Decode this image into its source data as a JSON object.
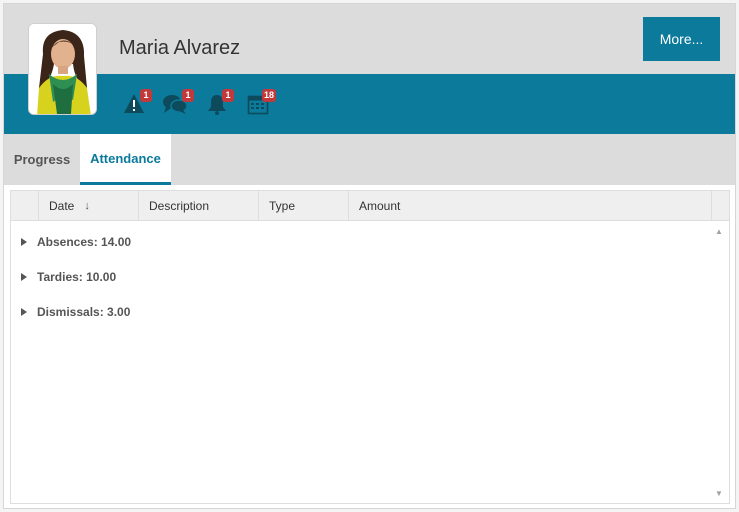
{
  "student": {
    "name": "Maria Alvarez"
  },
  "header": {
    "more_label": "More..."
  },
  "alerts": [
    {
      "icon": "warning-icon",
      "count": "1"
    },
    {
      "icon": "chat-icon",
      "count": "1"
    },
    {
      "icon": "bell-icon",
      "count": "1"
    },
    {
      "icon": "calendar-icon",
      "count": "18"
    }
  ],
  "tabs": [
    {
      "label": "Progress",
      "active": false
    },
    {
      "label": "Attendance",
      "active": true
    }
  ],
  "grid": {
    "columns": [
      {
        "label": "Date",
        "sort": "descending"
      },
      {
        "label": "Description"
      },
      {
        "label": "Type"
      },
      {
        "label": "Amount"
      }
    ],
    "groups": [
      {
        "label": "Absences: 14.00"
      },
      {
        "label": "Tardies: 10.00"
      },
      {
        "label": "Dismissals: 3.00"
      }
    ]
  },
  "colors": {
    "accent": "#0b7a9b",
    "header_bg": "#dcdcdc",
    "badge": "#c0393b"
  }
}
